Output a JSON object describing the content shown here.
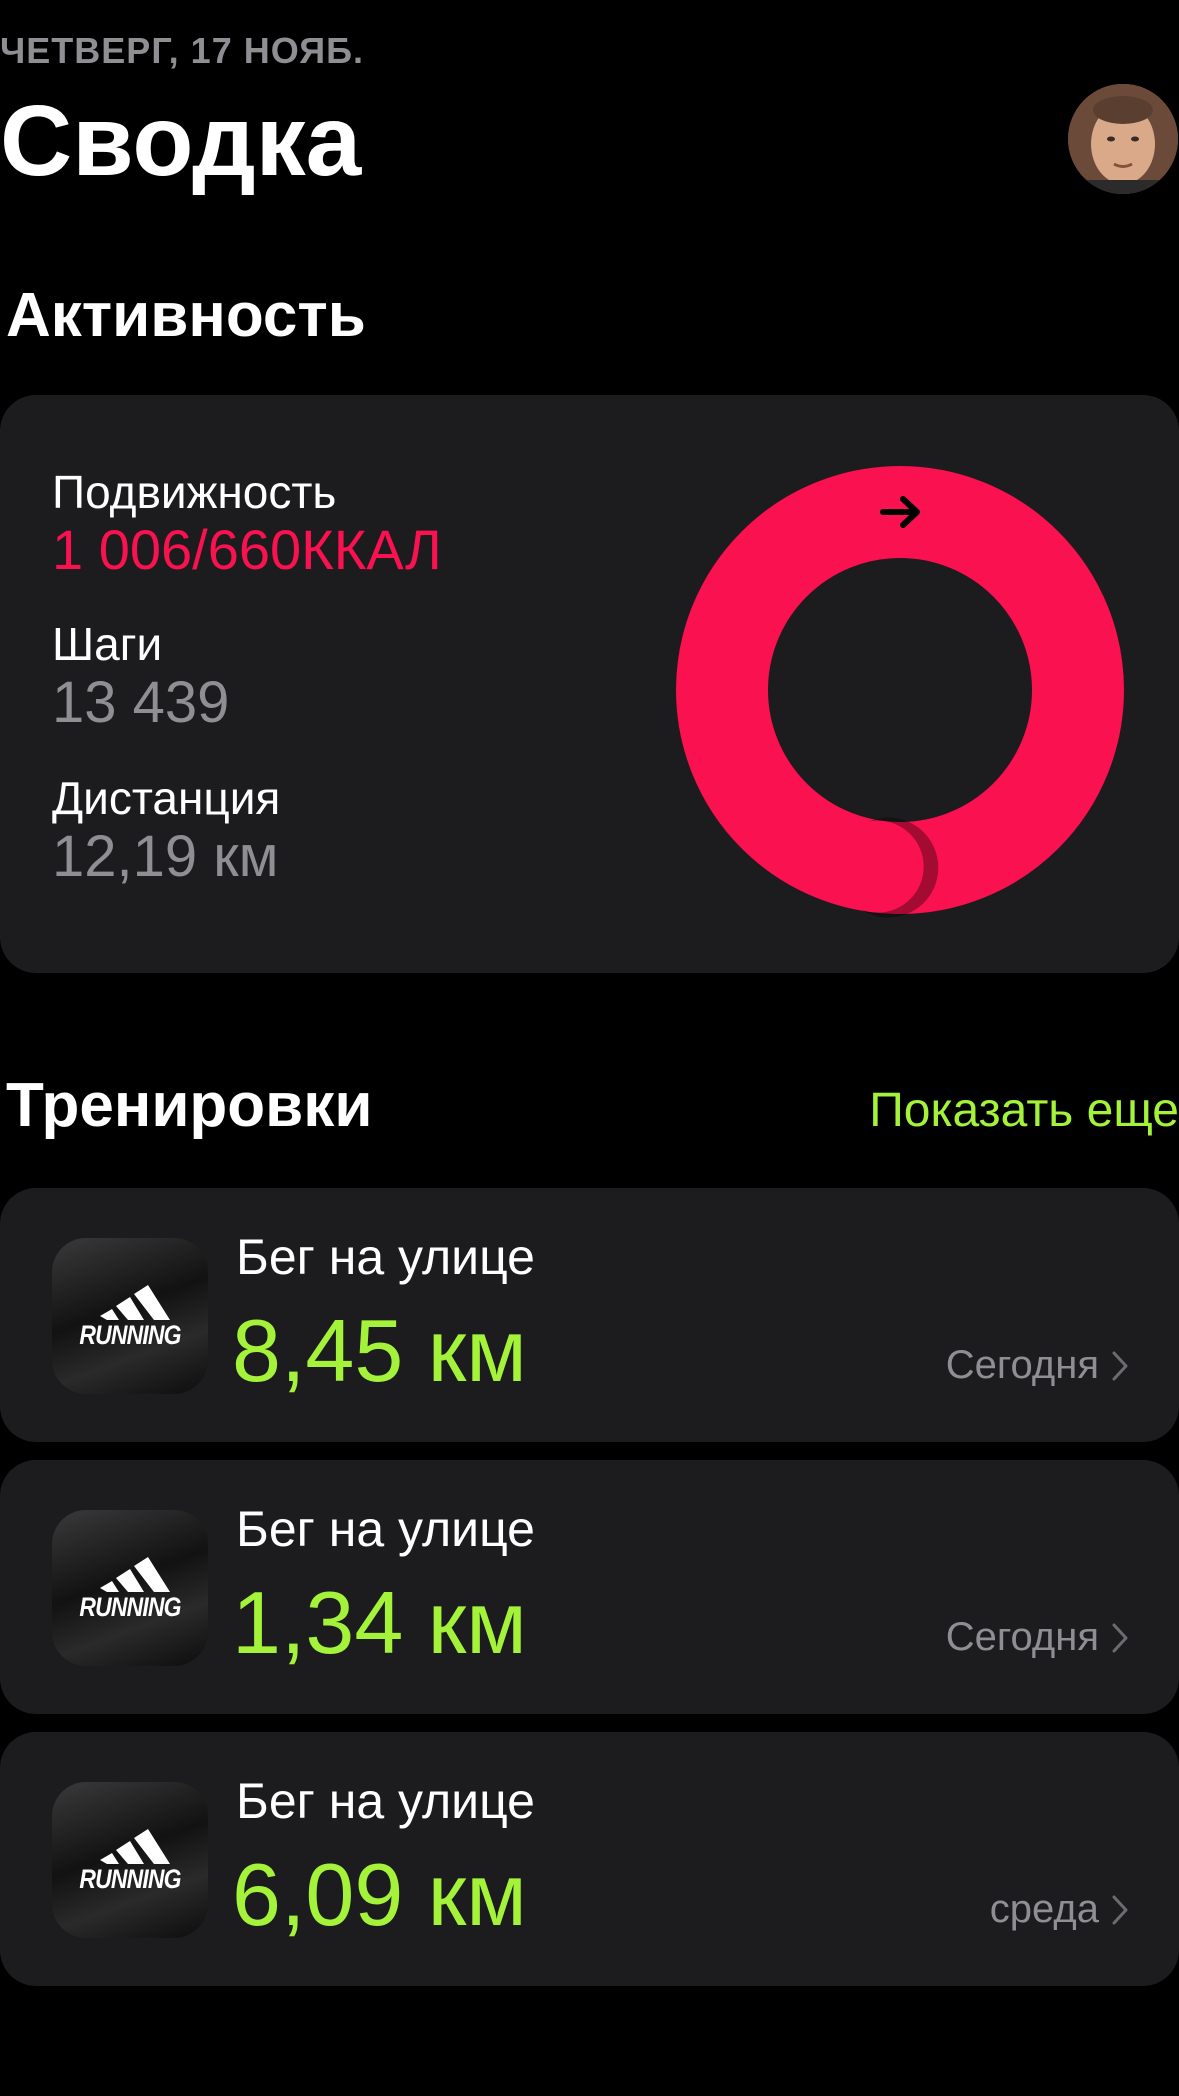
{
  "header": {
    "date": "ЧЕТВЕРГ, 17 НОЯБ.",
    "title": "Сводка"
  },
  "activity": {
    "section_title": "Активность",
    "move_label": "Подвижность",
    "move_value": "1 006/660ККАЛ",
    "move_progress_percent": 152,
    "steps_label": "Шаги",
    "steps_value": "13 439",
    "distance_label": "Дистанция",
    "distance_value": "12,19 км",
    "ring_color": "#fa114f"
  },
  "workouts": {
    "section_title": "Тренировки",
    "show_more": "Показать еще",
    "accent_color": "#a4f33a",
    "items": [
      {
        "name": "Бег на улице",
        "distance": "8,45 км",
        "date": "Сегодня",
        "app_label": "RUNNING",
        "icon": "adidas-running-app-icon"
      },
      {
        "name": "Бег на улице",
        "distance": "1,34 км",
        "date": "Сегодня",
        "app_label": "RUNNING",
        "icon": "adidas-running-app-icon"
      },
      {
        "name": "Бег на улице",
        "distance": "6,09 км",
        "date": "среда",
        "app_label": "RUNNING",
        "icon": "adidas-running-app-icon"
      }
    ]
  }
}
